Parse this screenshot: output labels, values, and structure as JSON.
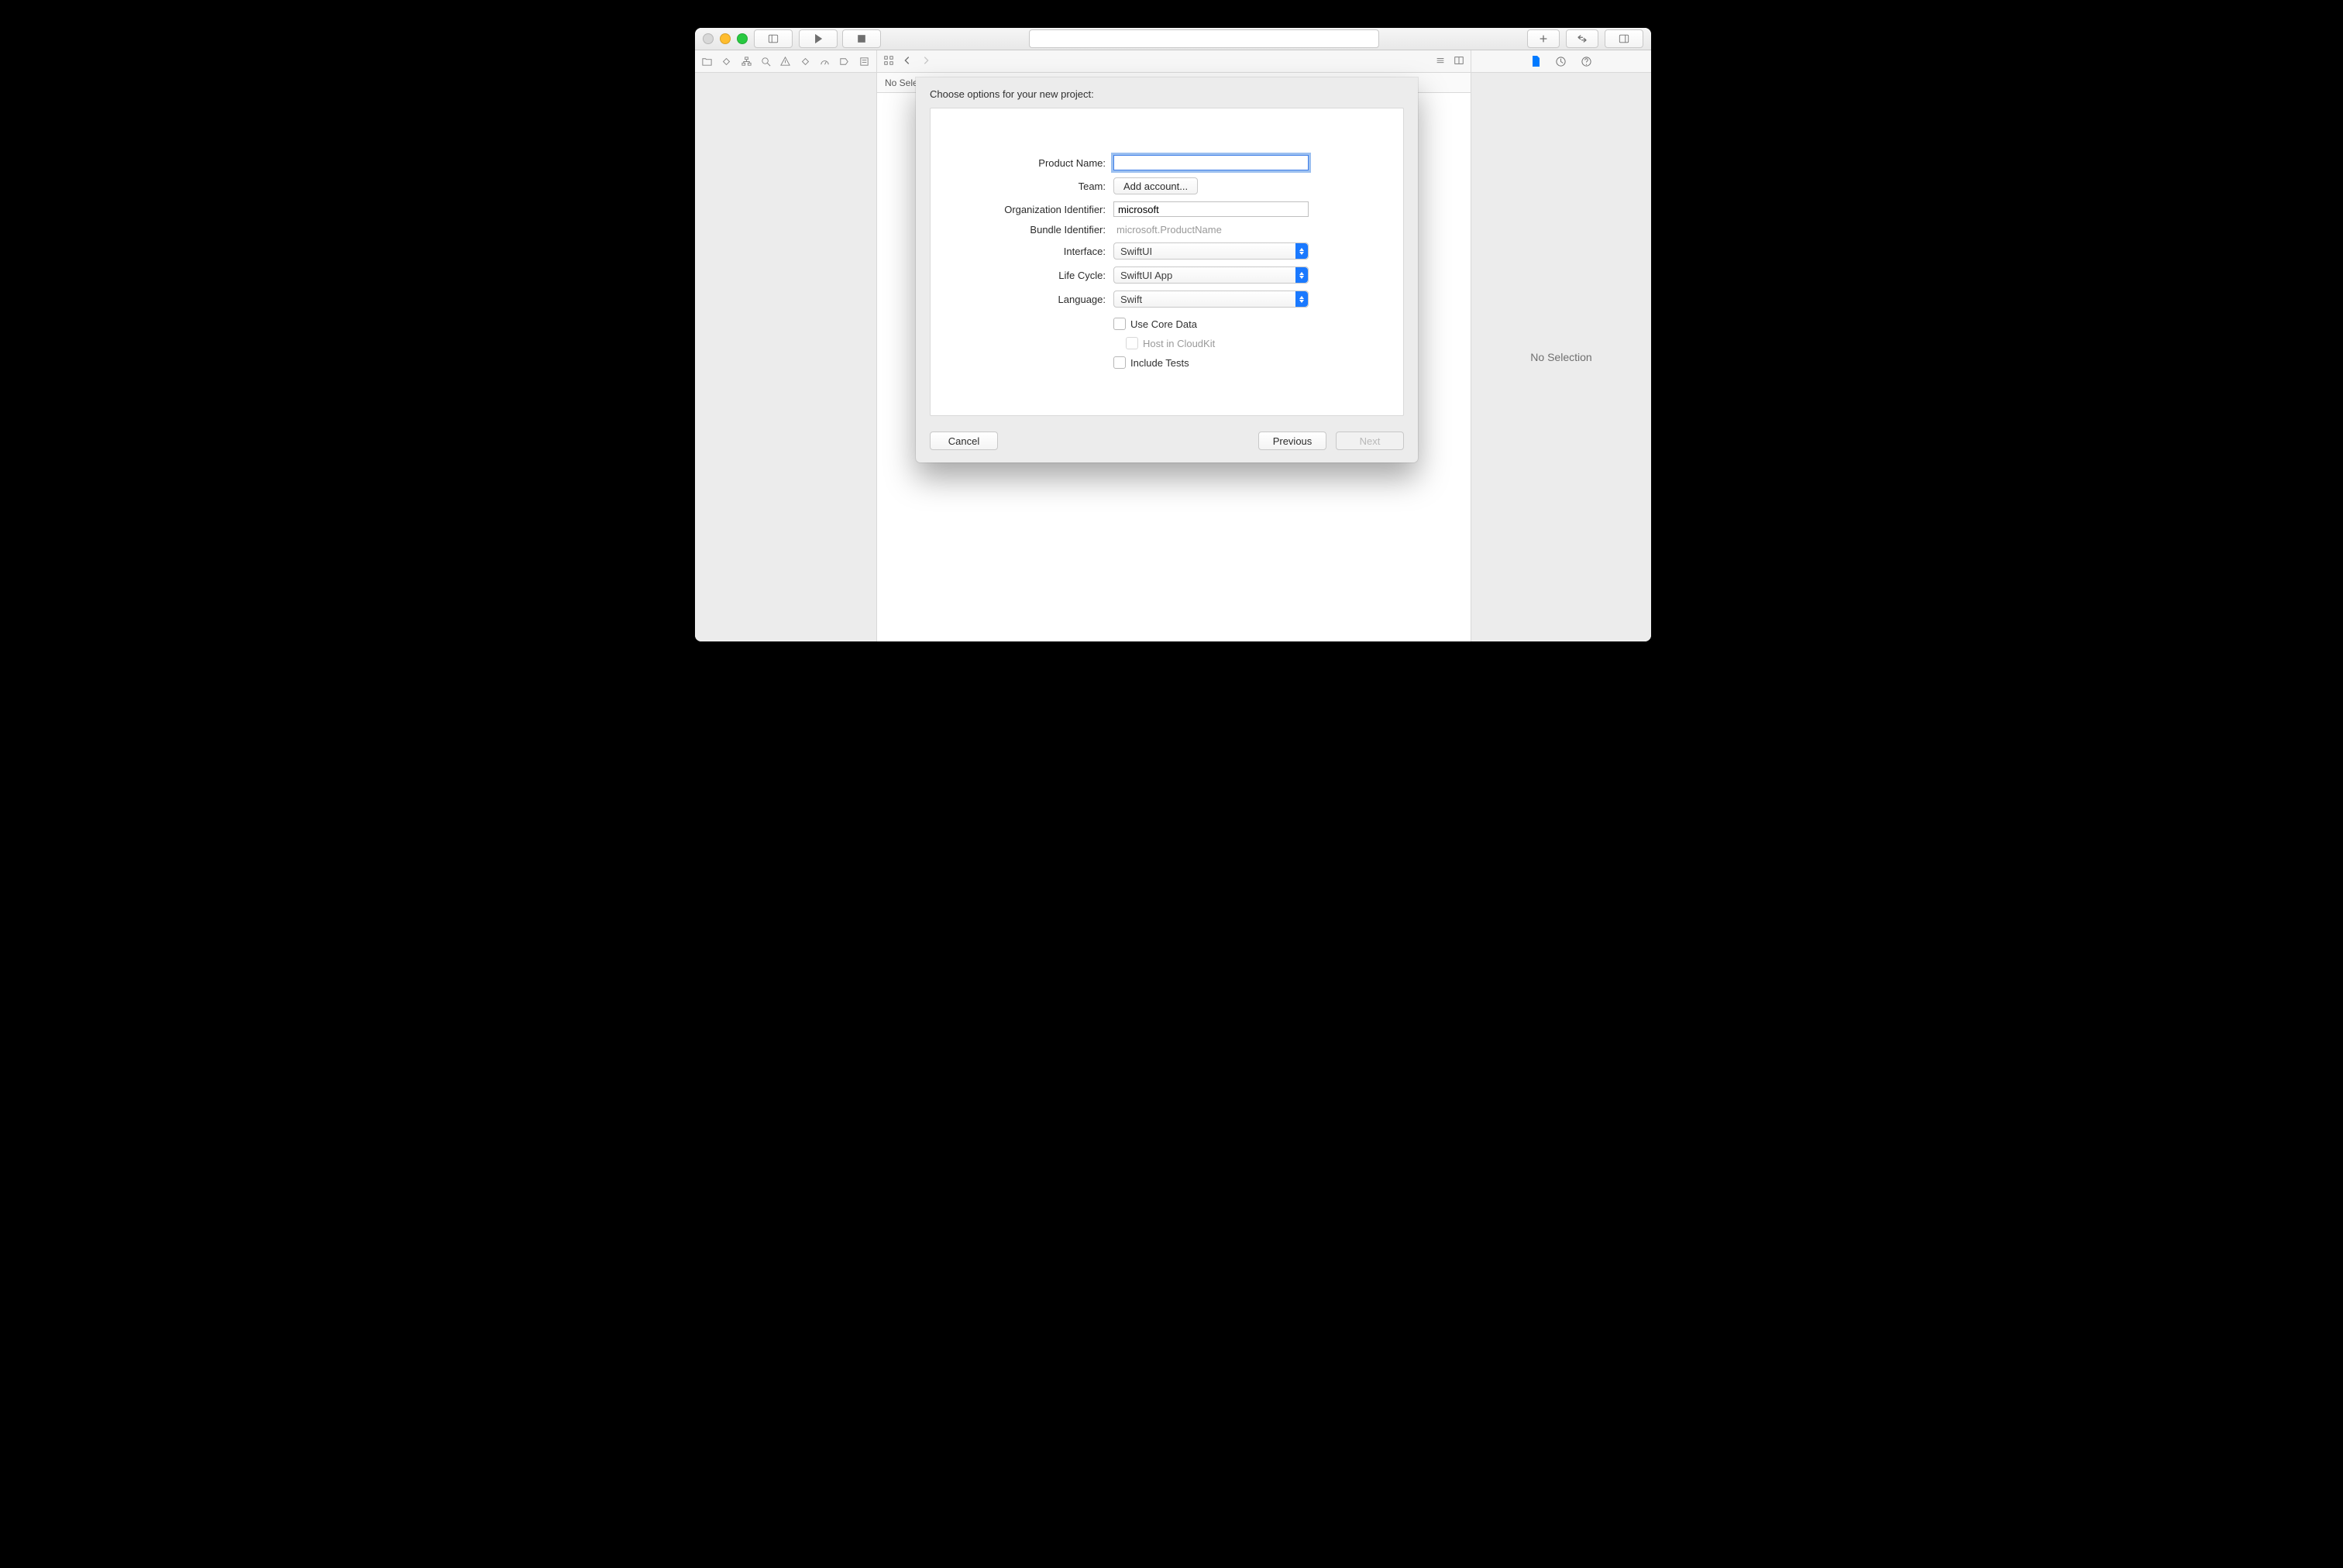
{
  "titlebar": {
    "traffic_colors": {
      "close": "#d8d8d8",
      "min": "#ffbd2e",
      "max": "#28c940"
    }
  },
  "navigator": {
    "tab_icons": [
      "folder",
      "scm",
      "hierarchy",
      "search",
      "warning",
      "tests",
      "debug",
      "breakpoints",
      "reports"
    ]
  },
  "center": {
    "no_selection_bar": "No Selection"
  },
  "inspector": {
    "tabs": [
      "file",
      "history",
      "help"
    ],
    "empty": "No Selection"
  },
  "sheet": {
    "title": "Choose options for your new project:",
    "labels": {
      "product_name": "Product Name:",
      "team": "Team:",
      "org_id": "Organization Identifier:",
      "bundle_id": "Bundle Identifier:",
      "interface": "Interface:",
      "lifecycle": "Life Cycle:",
      "language": "Language:"
    },
    "values": {
      "product_name": "",
      "team_button": "Add account...",
      "org_id": "microsoft",
      "bundle_id": "microsoft.ProductName",
      "interface": "SwiftUI",
      "lifecycle": "SwiftUI App",
      "language": "Swift"
    },
    "checks": {
      "core_data": "Use Core Data",
      "cloudkit": "Host in CloudKit",
      "tests": "Include Tests"
    },
    "buttons": {
      "cancel": "Cancel",
      "previous": "Previous",
      "next": "Next"
    }
  }
}
